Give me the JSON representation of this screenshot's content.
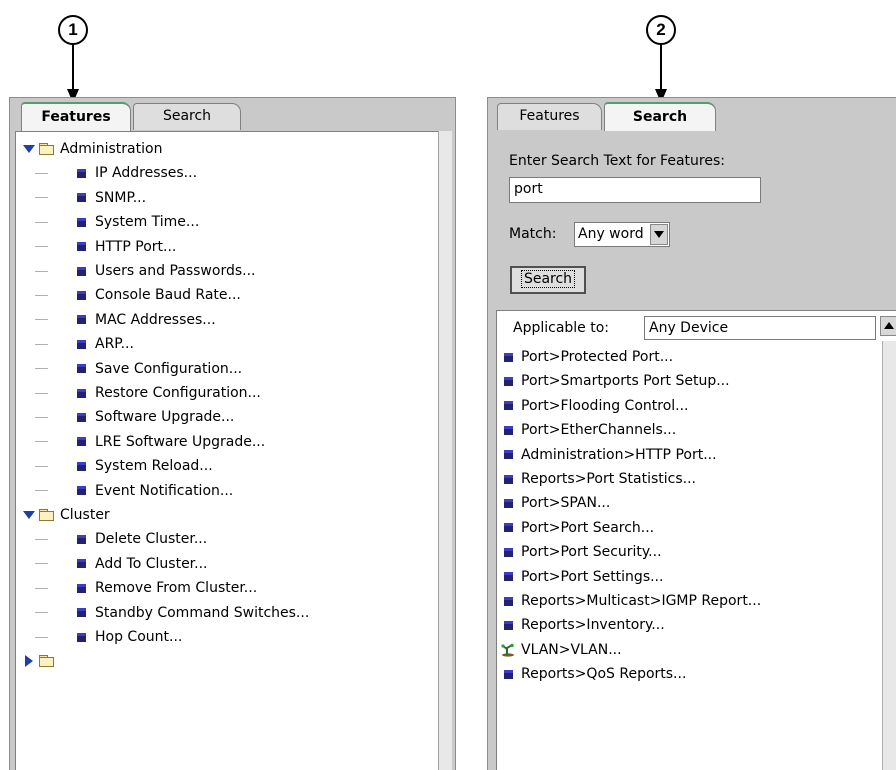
{
  "callouts": {
    "left": "1",
    "right": "2"
  },
  "left_panel": {
    "tabs": [
      {
        "label": "Features",
        "active": true
      },
      {
        "label": "Search",
        "active": false
      }
    ],
    "tree": [
      {
        "folder": "Administration",
        "expanded": true,
        "items": [
          "IP Addresses...",
          "SNMP...",
          "System Time...",
          "HTTP Port...",
          "Users and Passwords...",
          "Console Baud Rate...",
          "MAC Addresses...",
          "ARP...",
          "Save Configuration...",
          "Restore Configuration...",
          "Software Upgrade...",
          "LRE Software Upgrade...",
          "System Reload...",
          "Event Notification..."
        ]
      },
      {
        "folder": "Cluster",
        "expanded": true,
        "items": [
          "Delete Cluster...",
          "Add To Cluster...",
          "Remove From Cluster...",
          "Standby Command Switches...",
          "Hop Count..."
        ]
      }
    ]
  },
  "right_panel": {
    "tabs": [
      {
        "label": "Features",
        "active": false
      },
      {
        "label": "Search",
        "active": true
      }
    ],
    "search_prompt": "Enter Search Text for Features:",
    "search_value": "port",
    "match_label": "Match:",
    "match_value": "Any word",
    "search_button": "Search",
    "applicable_label": "Applicable to:",
    "applicable_value": "Any Device",
    "results": [
      {
        "label": "Port>Protected Port...",
        "icon": "feature-icon"
      },
      {
        "label": "Port>Smartports Port Setup...",
        "icon": "feature-icon"
      },
      {
        "label": "Port>Flooding Control...",
        "icon": "feature-icon"
      },
      {
        "label": "Port>EtherChannels...",
        "icon": "feature-icon"
      },
      {
        "label": "Administration>HTTP Port...",
        "icon": "feature-icon"
      },
      {
        "label": "Reports>Port Statistics...",
        "icon": "feature-icon"
      },
      {
        "label": "Port>SPAN...",
        "icon": "feature-icon"
      },
      {
        "label": "Port>Port Search...",
        "icon": "feature-icon"
      },
      {
        "label": "Port>Port Security...",
        "icon": "feature-icon"
      },
      {
        "label": "Port>Port Settings...",
        "icon": "feature-icon"
      },
      {
        "label": "Reports>Multicast>IGMP Report...",
        "icon": "feature-icon"
      },
      {
        "label": "Reports>Inventory...",
        "icon": "feature-icon"
      },
      {
        "label": "VLAN>VLAN...",
        "icon": "vlan-icon"
      },
      {
        "label": "Reports>QoS Reports...",
        "icon": "feature-icon"
      }
    ]
  },
  "colors": {
    "panel_bg": "#c9c9c9",
    "active_tab_accent": "#5a9a6e",
    "expander": "#1f3fa8",
    "feature_icon": "#23236b"
  }
}
